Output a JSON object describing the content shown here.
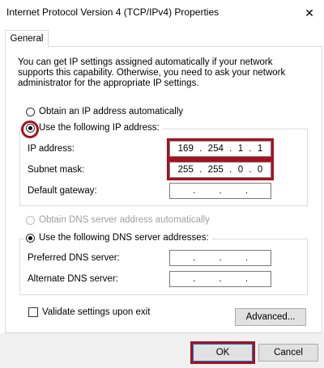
{
  "window": {
    "title": "Internet Protocol Version 4 (TCP/IPv4) Properties",
    "close_glyph": "✕"
  },
  "tabs": [
    {
      "label": "General"
    }
  ],
  "description": "You can get IP settings assigned automatically if your network supports this capability. Otherwise, you need to ask your network administrator for the appropriate IP settings.",
  "ip_section": {
    "auto_label": "Obtain an IP address automatically",
    "manual_label": "Use the following IP address:",
    "selected": "manual",
    "fields": [
      {
        "label": "IP address:",
        "octets": [
          "169",
          "254",
          "1",
          "1"
        ]
      },
      {
        "label": "Subnet mask:",
        "octets": [
          "255",
          "255",
          "0",
          "0"
        ]
      },
      {
        "label": "Default gateway:",
        "octets": [
          "",
          "",
          "",
          ""
        ]
      }
    ]
  },
  "dns_section": {
    "auto_label": "Obtain DNS server address automatically",
    "manual_label": "Use the following DNS server addresses:",
    "selected": "manual",
    "fields": [
      {
        "label": "Preferred DNS server:",
        "octets": [
          "",
          "",
          "",
          ""
        ]
      },
      {
        "label": "Alternate DNS server:",
        "octets": [
          "",
          "",
          "",
          ""
        ]
      }
    ]
  },
  "validate_label": "Validate settings upon exit",
  "validate_checked": false,
  "advanced_label": "Advanced...",
  "ok_label": "OK",
  "cancel_label": "Cancel",
  "highlight_color": "#a8101f"
}
